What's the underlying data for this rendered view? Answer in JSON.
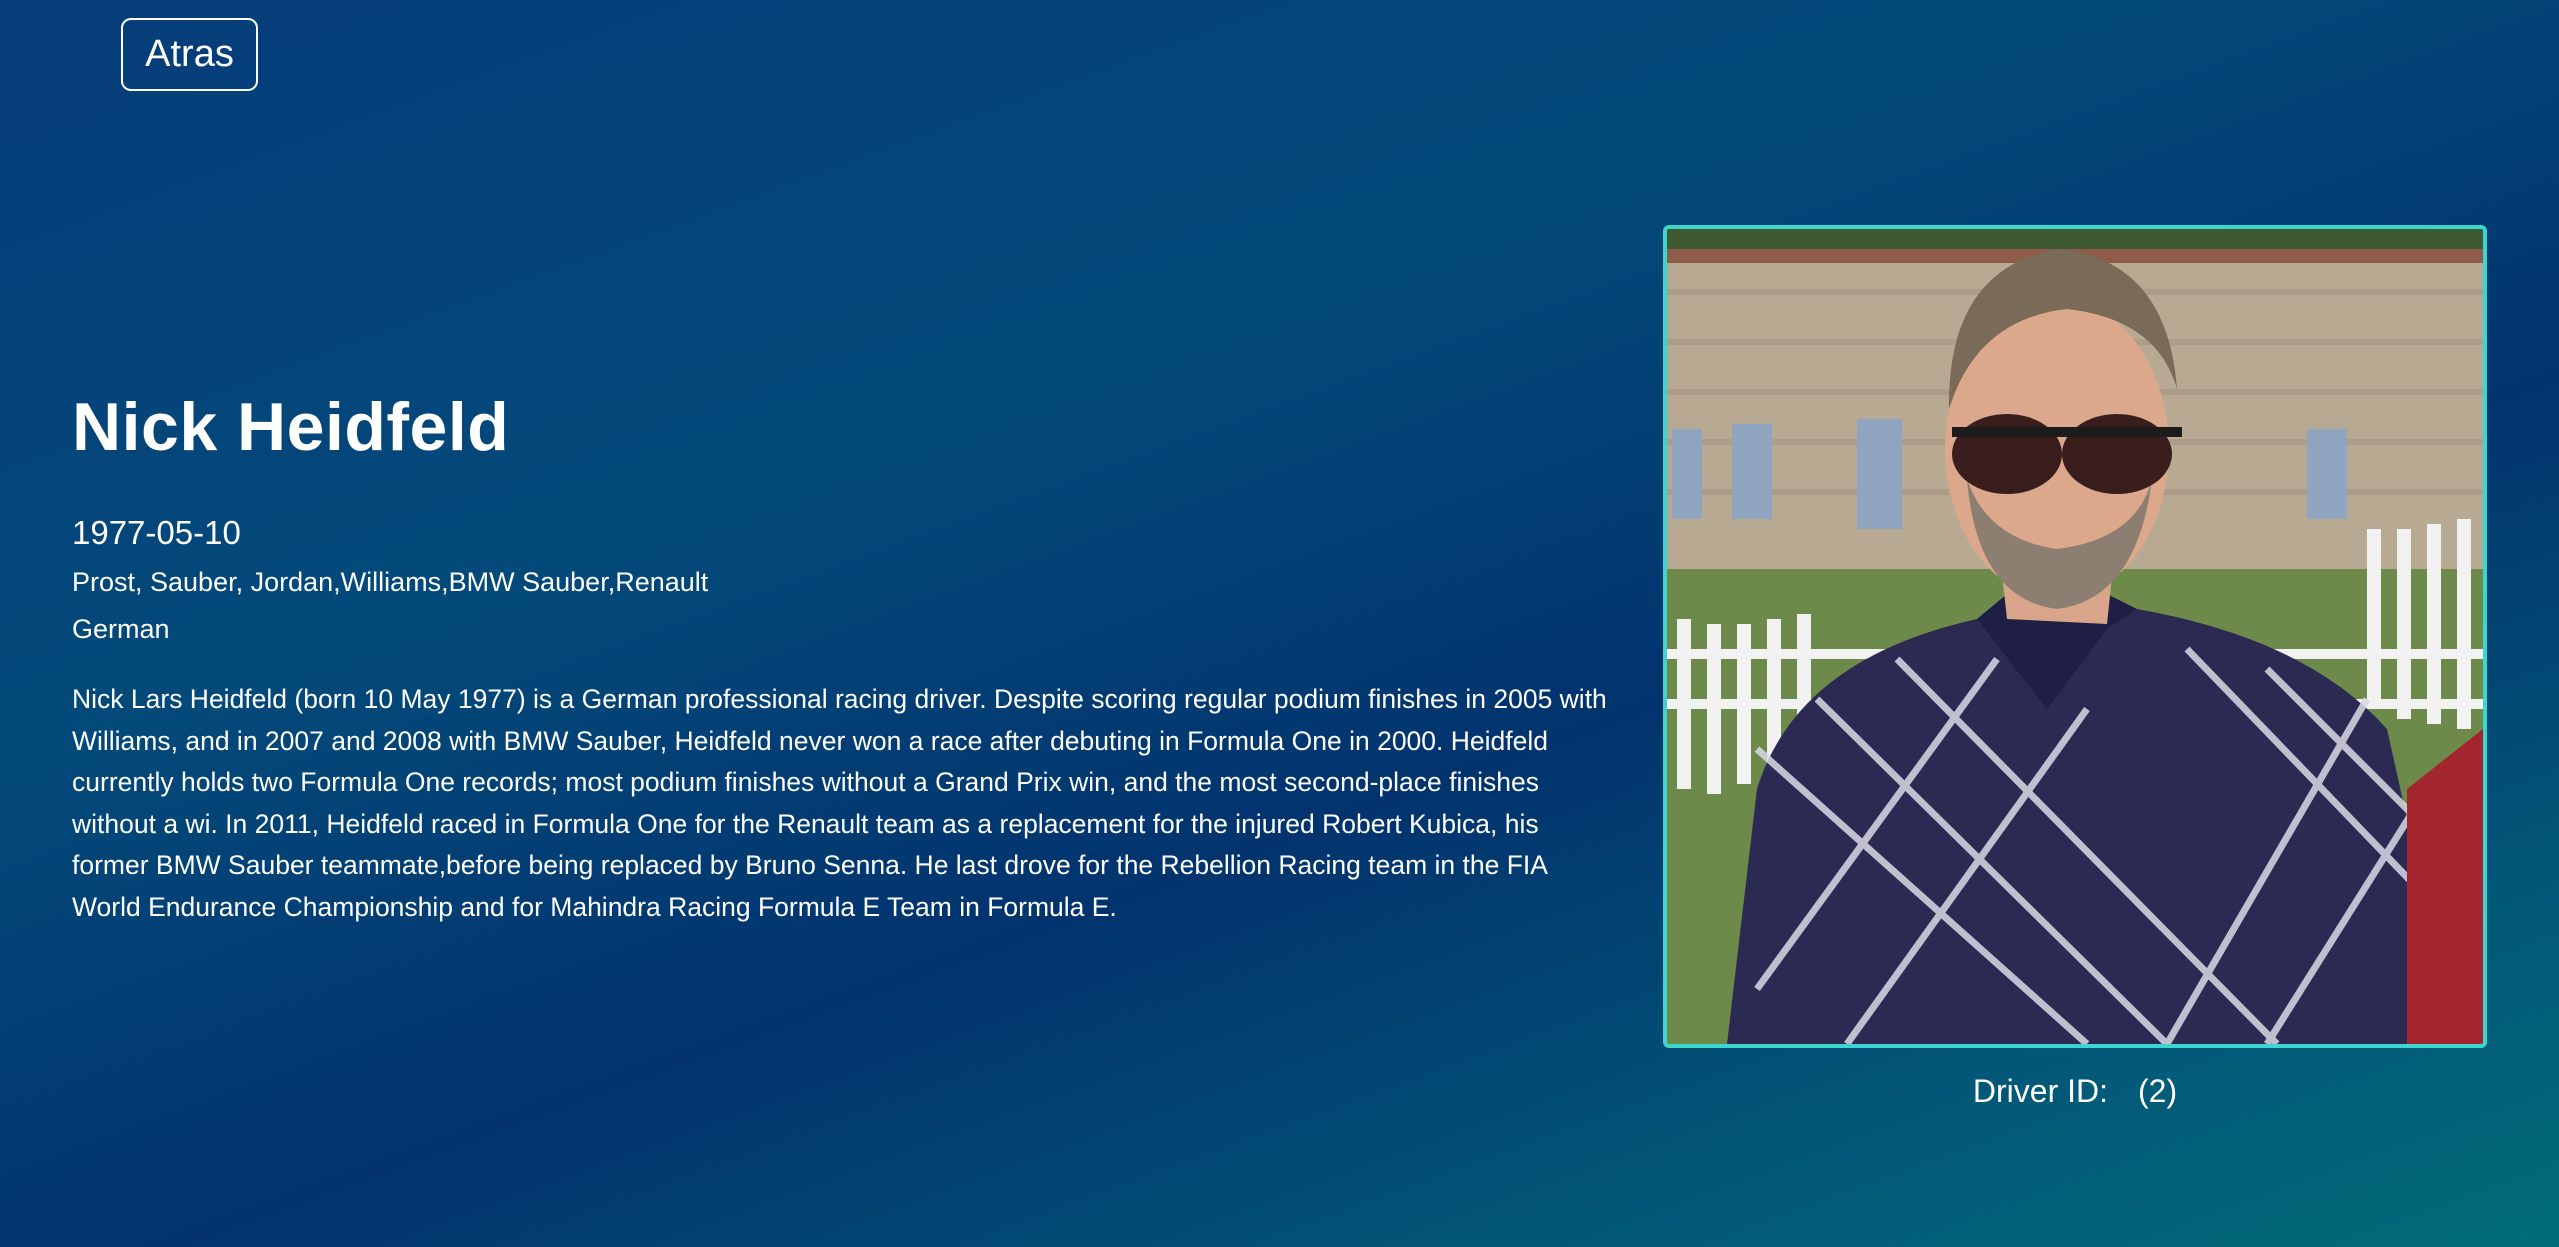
{
  "nav": {
    "back_label": "Atras"
  },
  "driver": {
    "name": "Nick Heidfeld",
    "dob": "1977-05-10",
    "teams": "Prost, Sauber, Jordan,Williams,BMW Sauber,Renault",
    "nationality": "German",
    "bio": "Nick Lars Heidfeld (born 10 May 1977) is a German professional racing driver. Despite scoring regular podium finishes in 2005 with Williams, and in 2007 and 2008 with BMW Sauber, Heidfeld never won a race after debuting in Formula One in 2000. Heidfeld currently holds two Formula One records; most podium finishes without a Grand Prix win, and the most second-place finishes without a wi. In 2011, Heidfeld raced in Formula One for the Renault team as a replacement for the injured Robert Kubica, his former BMW Sauber teammate,before being replaced by Bruno Senna. He last drove for the Rebellion Racing team in the FIA World Endurance Championship and for Mahindra Racing Formula E Team in Formula E.",
    "id_label": "Driver ID:",
    "id_value": "(2)"
  },
  "colors": {
    "photo_border": "#3cd6cf",
    "text": "#ffffff"
  }
}
